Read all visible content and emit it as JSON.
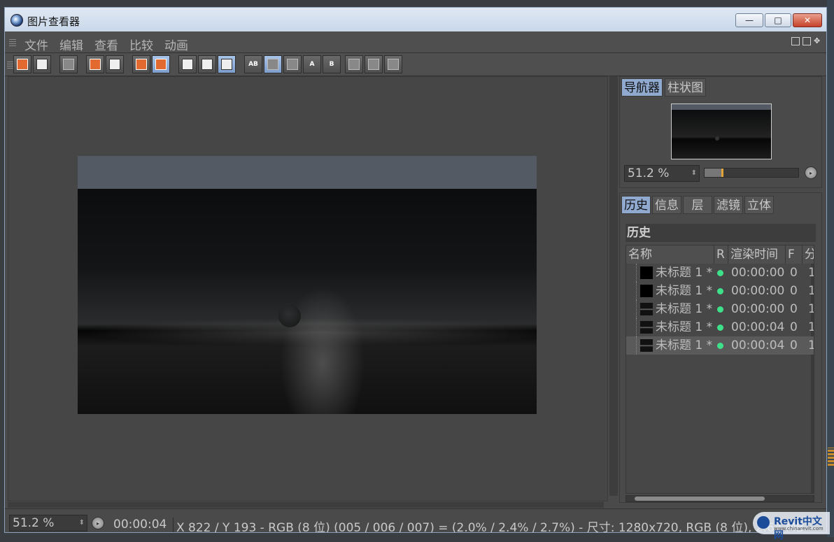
{
  "window": {
    "title": "图片查看器",
    "minimize": "—",
    "maximize": "□",
    "close": "✕"
  },
  "menu": [
    "文件",
    "编辑",
    "查看",
    "比较",
    "动画"
  ],
  "toolbar_buttons": [
    {
      "name": "open-file-button",
      "icon": "open-folder-icon",
      "on": false
    },
    {
      "name": "save-file-button",
      "icon": "save-icon",
      "on": false
    },
    {
      "name": "render-region-button",
      "icon": "grid-icon",
      "on": false
    },
    {
      "name": "copy-button",
      "icon": "copy-icon",
      "on": false
    },
    {
      "name": "user-button",
      "icon": "user-icon",
      "on": false
    },
    {
      "name": "delete-button",
      "icon": "delete-icon",
      "on": false
    },
    {
      "name": "delete-all-button",
      "icon": "delete-all-icon",
      "on": true
    },
    {
      "name": "view-a-button",
      "icon": "view-icon",
      "on": false
    },
    {
      "name": "view-b-button",
      "icon": "view-icon",
      "on": false
    },
    {
      "name": "filter-button",
      "icon": "filter-icon",
      "on": true
    },
    {
      "name": "compare-ab-button",
      "icon": "ab-icon",
      "on": false
    },
    {
      "name": "swap-ab-button",
      "icon": "swap-icon",
      "on": true
    },
    {
      "name": "split-ab-button",
      "icon": "split-icon",
      "on": false
    },
    {
      "name": "set-a-button",
      "icon": "a-icon",
      "on": false
    },
    {
      "name": "set-b-button",
      "icon": "b-icon",
      "on": false
    },
    {
      "name": "layout-1-button",
      "icon": "layout-icon",
      "on": false
    },
    {
      "name": "layout-2-button",
      "icon": "layout-icon",
      "on": false
    },
    {
      "name": "layout-3-button",
      "icon": "layout-icon",
      "on": false
    }
  ],
  "toolbar_text": {
    "ab": "AB",
    "a": "A",
    "b": "B"
  },
  "navigator": {
    "tabs": [
      "导航器",
      "柱状图"
    ],
    "zoom": "51.2 %",
    "zoom_spin": "⬍",
    "zoom_fraction": 0.18
  },
  "history": {
    "tabs": [
      "历史",
      "信息",
      "层",
      "滤镜",
      "立体"
    ],
    "title": "历史",
    "columns": [
      "名称",
      "R",
      "渲染时间",
      "F",
      "分"
    ],
    "rows": [
      {
        "name": "未标题 1 *",
        "time": "00:00:00",
        "f": "0",
        "s": "1",
        "lit": false,
        "sel": false
      },
      {
        "name": "未标题 1 *",
        "time": "00:00:00",
        "f": "0",
        "s": "1",
        "lit": false,
        "sel": false
      },
      {
        "name": "未标题 1 *",
        "time": "00:00:00",
        "f": "0",
        "s": "1",
        "lit": true,
        "sel": false
      },
      {
        "name": "未标题 1 *",
        "time": "00:00:04",
        "f": "0",
        "s": "1",
        "lit": true,
        "sel": false
      },
      {
        "name": "未标题 1 *",
        "time": "00:00:04",
        "f": "0",
        "s": "1",
        "lit": true,
        "sel": true
      }
    ]
  },
  "status": {
    "zoom": "51.2 %",
    "time": "00:00:04",
    "info": "X 822 / Y 193 - RGB (8 位) (005 / 006 / 007) = (2.0% / 2.4% / 2.7%) - 尺寸: 1280x720, RGB (8 位), 2.64 MB"
  },
  "watermark": {
    "main": "Revit中文网",
    "sub": "www.chinarevit.com"
  }
}
